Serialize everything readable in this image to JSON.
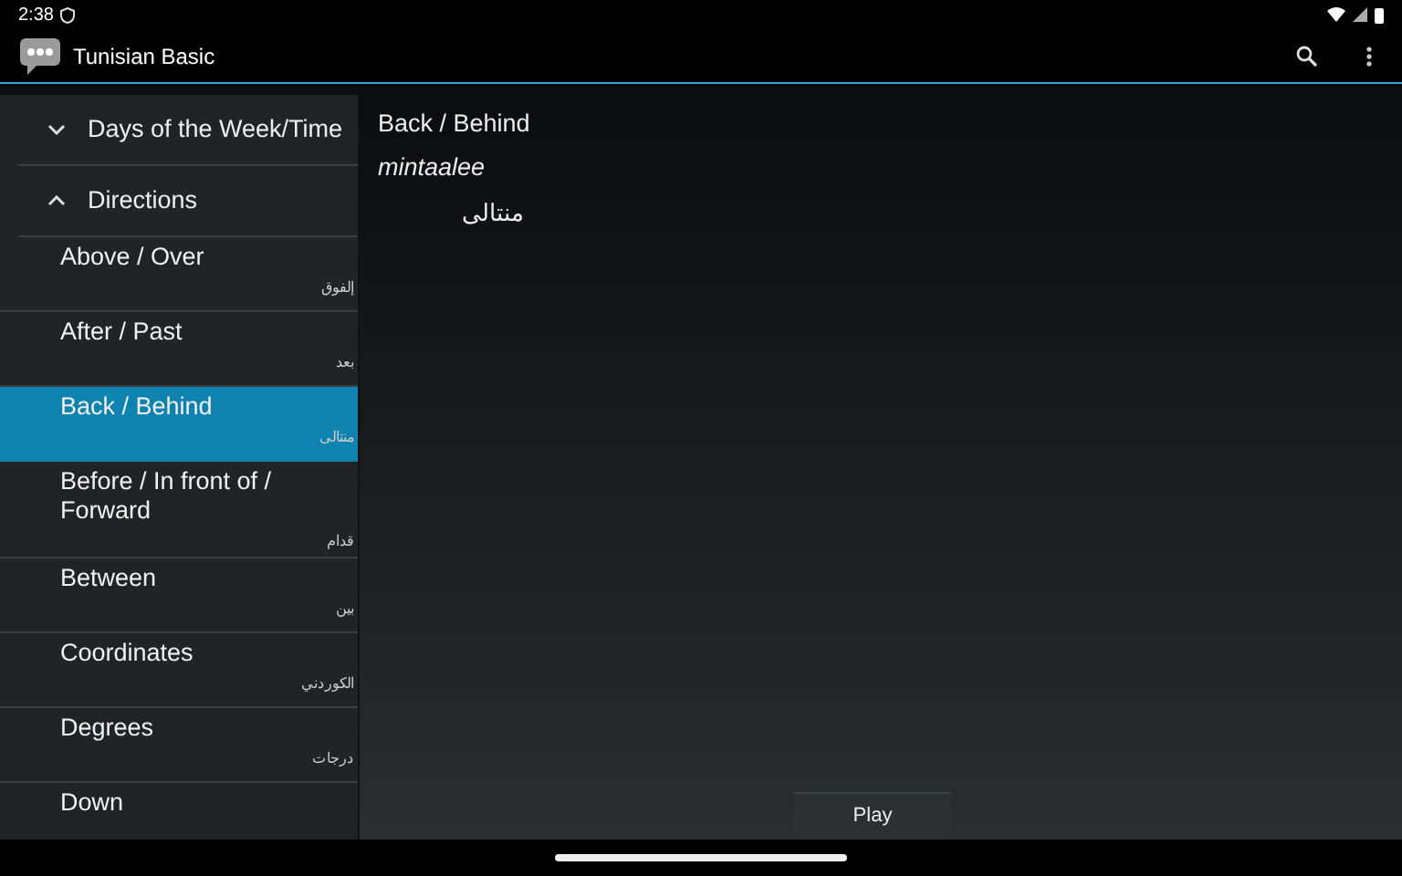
{
  "status_bar": {
    "time": "2:38"
  },
  "app_bar": {
    "title": "Tunisian Basic"
  },
  "sidebar": {
    "groups": [
      {
        "label": "Days of the Week/Time",
        "expanded": false
      },
      {
        "label": "Directions",
        "expanded": true,
        "children": [
          {
            "label": "Above / Over",
            "translation": "إلفوق",
            "selected": false
          },
          {
            "label": "After / Past",
            "translation": "بعد",
            "selected": false
          },
          {
            "label": "Back / Behind",
            "translation": "منتالى",
            "selected": true
          },
          {
            "label": "Before / In front of / Forward",
            "translation": "قدام",
            "selected": false
          },
          {
            "label": "Between",
            "translation": "بين",
            "selected": false
          },
          {
            "label": "Coordinates",
            "translation": "الكوردني",
            "selected": false
          },
          {
            "label": "Degrees",
            "translation": "درجات",
            "selected": false
          },
          {
            "label": "Down",
            "selected": false
          }
        ]
      }
    ]
  },
  "detail": {
    "phrase": "Back / Behind",
    "transliteration": "mintaalee",
    "arabic": "منتالى",
    "play_button": "Play"
  }
}
